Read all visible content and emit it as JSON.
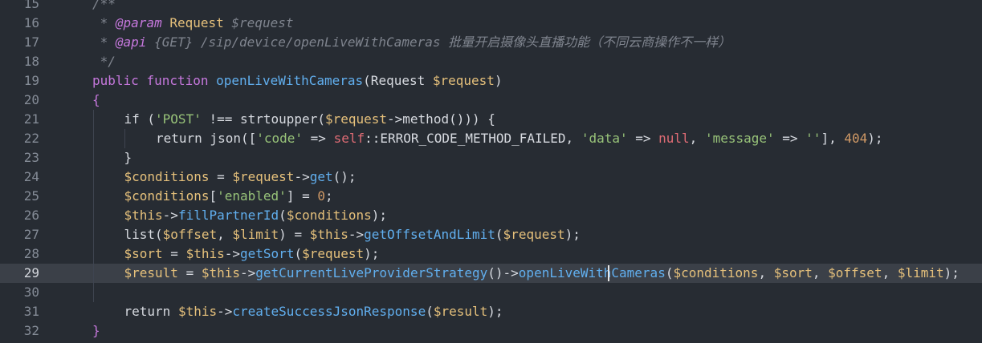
{
  "editor": {
    "active_line": 29,
    "caret": {
      "line": 29,
      "column": 55
    },
    "theme_colors": {
      "background": "#272c33",
      "active_line": "#3b4048",
      "comment": "#7f848e",
      "keyword": "#c678dd",
      "function": "#61afef",
      "variable": "#e5c07b",
      "string": "#98c379",
      "number": "#d19a66",
      "constant": "#e06c75"
    }
  },
  "lines": [
    {
      "num": "15",
      "indent": 1,
      "tokens": [
        {
          "t": "/**",
          "c": "comment"
        }
      ]
    },
    {
      "num": "16",
      "indent": 1,
      "tokens": [
        {
          "t": " * ",
          "c": "comment"
        },
        {
          "t": "@param",
          "c": "doctag"
        },
        {
          "t": " ",
          "c": "comment"
        },
        {
          "t": "Request",
          "c": "type"
        },
        {
          "t": " $request",
          "c": "comment"
        }
      ]
    },
    {
      "num": "17",
      "indent": 1,
      "tokens": [
        {
          "t": " * ",
          "c": "comment"
        },
        {
          "t": "@api",
          "c": "doctag"
        },
        {
          "t": " {GET} /sip/device/openLiveWithCameras 批量开启摄像头直播功能（不同云商操作不一样）",
          "c": "comment"
        }
      ]
    },
    {
      "num": "18",
      "indent": 1,
      "tokens": [
        {
          "t": " */",
          "c": "comment"
        }
      ]
    },
    {
      "num": "19",
      "indent": 1,
      "tokens": [
        {
          "t": "public",
          "c": "keyword"
        },
        {
          "t": " ",
          "c": "plain"
        },
        {
          "t": "function",
          "c": "keyword"
        },
        {
          "t": " ",
          "c": "plain"
        },
        {
          "t": "openLiveWithCameras",
          "c": "function"
        },
        {
          "t": "(Request ",
          "c": "plain"
        },
        {
          "t": "$request",
          "c": "variable"
        },
        {
          "t": ")",
          "c": "plain"
        }
      ]
    },
    {
      "num": "20",
      "indent": 1,
      "tokens": [
        {
          "t": "{",
          "c": "bracket"
        }
      ]
    },
    {
      "num": "21",
      "indent": 2,
      "tokens": [
        {
          "t": "if",
          "c": "plain"
        },
        {
          "t": " (",
          "c": "plain"
        },
        {
          "t": "'POST'",
          "c": "string"
        },
        {
          "t": " !== strtoupper(",
          "c": "plain"
        },
        {
          "t": "$request",
          "c": "variable"
        },
        {
          "t": "->method())) {",
          "c": "plain"
        }
      ]
    },
    {
      "num": "22",
      "indent": 3,
      "tokens": [
        {
          "t": "return",
          "c": "plain"
        },
        {
          "t": " json([",
          "c": "plain"
        },
        {
          "t": "'code'",
          "c": "string"
        },
        {
          "t": " => ",
          "c": "plain"
        },
        {
          "t": "self",
          "c": "self"
        },
        {
          "t": "::ERROR_CODE_METHOD_FAILED, ",
          "c": "plain"
        },
        {
          "t": "'data'",
          "c": "string"
        },
        {
          "t": " => ",
          "c": "plain"
        },
        {
          "t": "null",
          "c": "constant"
        },
        {
          "t": ", ",
          "c": "plain"
        },
        {
          "t": "'message'",
          "c": "string"
        },
        {
          "t": " => ",
          "c": "plain"
        },
        {
          "t": "''",
          "c": "string"
        },
        {
          "t": "], ",
          "c": "plain"
        },
        {
          "t": "404",
          "c": "number"
        },
        {
          "t": ");",
          "c": "plain"
        }
      ]
    },
    {
      "num": "23",
      "indent": 2,
      "tokens": [
        {
          "t": "}",
          "c": "plain"
        }
      ]
    },
    {
      "num": "24",
      "indent": 2,
      "tokens": [
        {
          "t": "$conditions",
          "c": "variable"
        },
        {
          "t": " = ",
          "c": "plain"
        },
        {
          "t": "$request",
          "c": "variable"
        },
        {
          "t": "->",
          "c": "plain"
        },
        {
          "t": "get",
          "c": "function"
        },
        {
          "t": "();",
          "c": "plain"
        }
      ]
    },
    {
      "num": "25",
      "indent": 2,
      "tokens": [
        {
          "t": "$conditions",
          "c": "variable"
        },
        {
          "t": "[",
          "c": "plain"
        },
        {
          "t": "'enabled'",
          "c": "string"
        },
        {
          "t": "] = ",
          "c": "plain"
        },
        {
          "t": "0",
          "c": "number"
        },
        {
          "t": ";",
          "c": "plain"
        }
      ]
    },
    {
      "num": "26",
      "indent": 2,
      "tokens": [
        {
          "t": "$this",
          "c": "variable"
        },
        {
          "t": "->",
          "c": "plain"
        },
        {
          "t": "fillPartnerId",
          "c": "function"
        },
        {
          "t": "(",
          "c": "plain"
        },
        {
          "t": "$conditions",
          "c": "variable"
        },
        {
          "t": ");",
          "c": "plain"
        }
      ]
    },
    {
      "num": "27",
      "indent": 2,
      "tokens": [
        {
          "t": "list(",
          "c": "plain"
        },
        {
          "t": "$offset",
          "c": "variable"
        },
        {
          "t": ", ",
          "c": "plain"
        },
        {
          "t": "$limit",
          "c": "variable"
        },
        {
          "t": ") = ",
          "c": "plain"
        },
        {
          "t": "$this",
          "c": "variable"
        },
        {
          "t": "->",
          "c": "plain"
        },
        {
          "t": "getOffsetAndLimit",
          "c": "function"
        },
        {
          "t": "(",
          "c": "plain"
        },
        {
          "t": "$request",
          "c": "variable"
        },
        {
          "t": ");",
          "c": "plain"
        }
      ]
    },
    {
      "num": "28",
      "indent": 2,
      "tokens": [
        {
          "t": "$sort",
          "c": "variable"
        },
        {
          "t": " = ",
          "c": "plain"
        },
        {
          "t": "$this",
          "c": "variable"
        },
        {
          "t": "->",
          "c": "plain"
        },
        {
          "t": "getSort",
          "c": "function"
        },
        {
          "t": "(",
          "c": "plain"
        },
        {
          "t": "$request",
          "c": "variable"
        },
        {
          "t": ");",
          "c": "plain"
        }
      ]
    },
    {
      "num": "29",
      "indent": 2,
      "tokens": [
        {
          "t": "$result",
          "c": "variable"
        },
        {
          "t": " = ",
          "c": "plain"
        },
        {
          "t": "$this",
          "c": "variable"
        },
        {
          "t": "->",
          "c": "plain"
        },
        {
          "t": "getCurrentLiveProviderStrategy",
          "c": "function"
        },
        {
          "t": "()->",
          "c": "plain"
        },
        {
          "t": "openLiveWithCameras",
          "c": "function"
        },
        {
          "t": "(",
          "c": "plain"
        },
        {
          "t": "$conditions",
          "c": "variable"
        },
        {
          "t": ", ",
          "c": "plain"
        },
        {
          "t": "$sort",
          "c": "variable"
        },
        {
          "t": ", ",
          "c": "plain"
        },
        {
          "t": "$offset",
          "c": "variable"
        },
        {
          "t": ", ",
          "c": "plain"
        },
        {
          "t": "$limit",
          "c": "variable"
        },
        {
          "t": ");",
          "c": "plain"
        }
      ]
    },
    {
      "num": "30",
      "indent": 2,
      "tokens": []
    },
    {
      "num": "31",
      "indent": 2,
      "tokens": [
        {
          "t": "return",
          "c": "plain"
        },
        {
          "t": " ",
          "c": "plain"
        },
        {
          "t": "$this",
          "c": "variable"
        },
        {
          "t": "->",
          "c": "plain"
        },
        {
          "t": "createSuccessJsonResponse",
          "c": "function"
        },
        {
          "t": "(",
          "c": "plain"
        },
        {
          "t": "$result",
          "c": "variable"
        },
        {
          "t": ");",
          "c": "plain"
        }
      ]
    },
    {
      "num": "32",
      "indent": 1,
      "tokens": [
        {
          "t": "}",
          "c": "bracket"
        }
      ]
    }
  ]
}
